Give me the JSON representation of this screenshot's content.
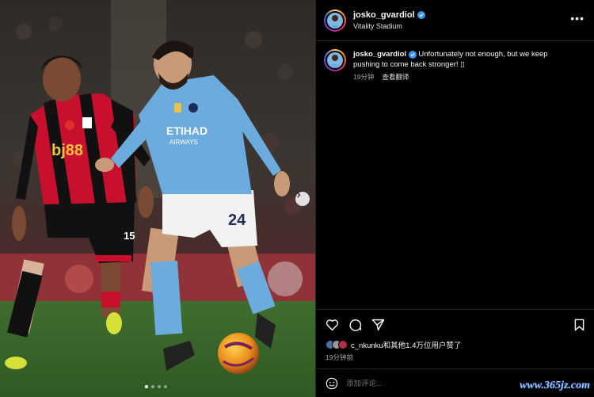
{
  "post": {
    "username": "josko_gvardiol",
    "location": "Vitality Stadium",
    "caption_user": "josko_gvardiol",
    "caption_text": "Unfortunately not enough, but we keep pushing to come back stronger! ",
    "caption_emoji": "▯",
    "caption_time": "19分钟",
    "translate_label": "查看翻译",
    "liked_by": "c_nkunku和其他1.4万位用户赞了",
    "post_time": "19分钟前",
    "comment_placeholder": "添加评论...",
    "more_label": "•••"
  },
  "photo": {
    "shirt_sponsor_left": "bj88",
    "shirt_number_left": "15",
    "shirt_sponsor_right": "ETIHAD",
    "shirt_sub_right": "AIRWAYS",
    "shirt_number_right": "24",
    "carousel_dots": 4,
    "active_dot": 0
  },
  "watermark": "www.365jz.com",
  "colors": {
    "background": "#000000",
    "verified": "#3897f0",
    "secondary_text": "#a8a8a8",
    "border": "#262626",
    "city_blue": "#6cabdd",
    "cherries_red": "#c8102e"
  }
}
